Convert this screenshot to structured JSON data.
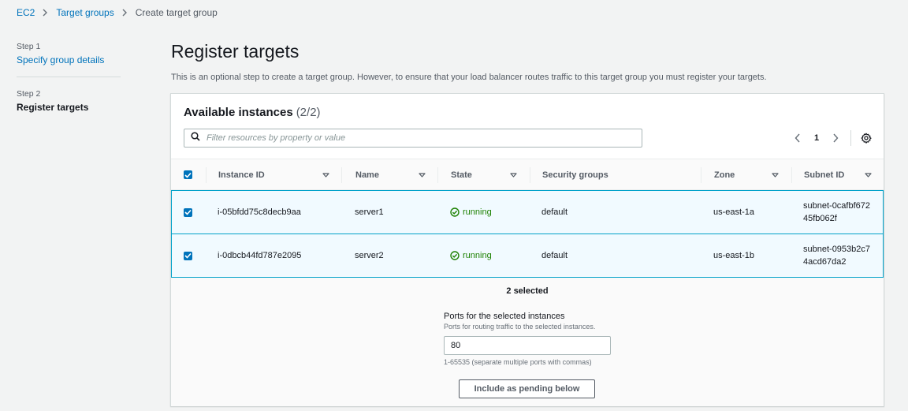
{
  "breadcrumb": {
    "items": [
      "EC2",
      "Target groups"
    ],
    "current": "Create target group"
  },
  "steps": [
    {
      "label": "Step 1",
      "name": "Specify group details"
    },
    {
      "label": "Step 2",
      "name": "Register targets"
    }
  ],
  "page": {
    "title": "Register targets",
    "description": "This is an optional step to create a target group. However, to ensure that your load balancer routes traffic to this target group you must register your targets."
  },
  "instances": {
    "header": "Available instances",
    "count": "(2/2)",
    "filter_placeholder": "Filter resources by property or value",
    "current_page": "1",
    "columns": [
      "Instance ID",
      "Name",
      "State",
      "Security groups",
      "Zone",
      "Subnet ID"
    ],
    "rows": [
      {
        "instance_id": "i-05bfdd75c8decb9aa",
        "name": "server1",
        "state": "running",
        "security_groups": "default",
        "zone": "us-east-1a",
        "subnet_id": "subnet-0cafbf67245fb062f",
        "checked": true
      },
      {
        "instance_id": "i-0dbcb44fd787e2095",
        "name": "server2",
        "state": "running",
        "security_groups": "default",
        "zone": "us-east-1b",
        "subnet_id": "subnet-0953b2c74acd67da2",
        "checked": true
      }
    ],
    "selected_text": "2 selected"
  },
  "ports": {
    "label": "Ports for the selected instances",
    "description": "Ports for routing traffic to the selected instances.",
    "value": "80",
    "hint": "1-65535 (separate multiple ports with commas)",
    "button": "Include as pending below"
  },
  "colors": {
    "link": "#0073bb",
    "selected_row_bg": "#f1faff",
    "selected_row_border": "#00a1c9",
    "running": "#1d8102"
  }
}
